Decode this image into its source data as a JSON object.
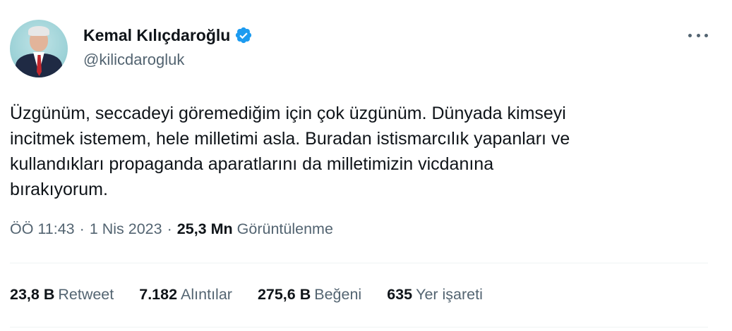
{
  "author": {
    "display_name": "Kemal Kılıçdaroğlu",
    "handle": "@kilicdarogluk",
    "verified_icon": "verified-badge-icon",
    "avatar": "profile-photo"
  },
  "tweet": {
    "text": "Üzgünüm, seccadeyi göremediğim için çok üzgünüm. Dünyada kimseyi\nincitmek istemem, hele milletimi asla. Buradan istismarcılık yapanları ve\nkullandıkları propaganda aparatlarını da milletimizin vicdanına\nbırakıyorum.",
    "time": "ÖÖ 11:43",
    "dot1": "·",
    "date": "1 Nis 2023",
    "dot2": "·",
    "views_count": "25,3 Mn",
    "views_label": "Görüntülenme"
  },
  "stats": {
    "retweets_count": "23,8 B",
    "retweets_label": "Retweet",
    "quotes_count": "7.182",
    "quotes_label": "Alıntılar",
    "likes_count": "275,6 B",
    "likes_label": "Beğeni",
    "bookmarks_count": "635",
    "bookmarks_label": "Yer işareti"
  },
  "colors": {
    "accent": "#1d9bf0",
    "text": "#0f1419",
    "secondary": "#536471",
    "divider": "#eff3f4"
  }
}
